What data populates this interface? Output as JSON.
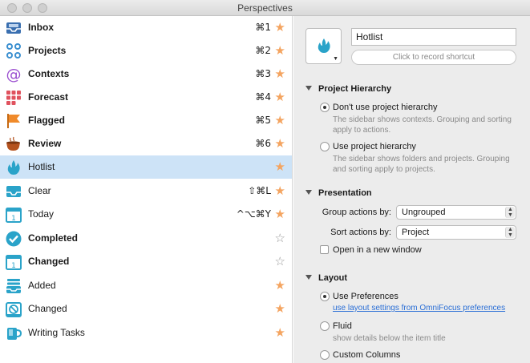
{
  "window": {
    "title": "Perspectives"
  },
  "perspectives": [
    {
      "label": "Inbox",
      "bold": true,
      "shortcut": "⌘1",
      "favorite": true,
      "icon": "inbox-icon",
      "color": "#3a6fb0"
    },
    {
      "label": "Projects",
      "bold": true,
      "shortcut": "⌘2",
      "favorite": true,
      "icon": "projects-icon",
      "color": "#3a8fd0"
    },
    {
      "label": "Contexts",
      "bold": true,
      "shortcut": "⌘3",
      "favorite": true,
      "icon": "contexts-icon",
      "color": "#9b4fd0"
    },
    {
      "label": "Forecast",
      "bold": true,
      "shortcut": "⌘4",
      "favorite": true,
      "icon": "forecast-icon",
      "color": "#e0525e"
    },
    {
      "label": "Flagged",
      "bold": true,
      "shortcut": "⌘5",
      "favorite": true,
      "icon": "flag-icon",
      "color": "#f08a2a"
    },
    {
      "label": "Review",
      "bold": true,
      "shortcut": "⌘6",
      "favorite": true,
      "icon": "review-icon",
      "color": "#b5521e"
    },
    {
      "label": "Hotlist",
      "bold": false,
      "shortcut": "",
      "favorite": true,
      "icon": "hotlist-flame-icon",
      "color": "#2aa3c9",
      "selected": true
    },
    {
      "label": "Clear",
      "bold": false,
      "shortcut": "⇧⌘L",
      "favorite": true,
      "icon": "clear-tray-icon",
      "color": "#2aa3c9"
    },
    {
      "label": "Today",
      "bold": false,
      "shortcut": "^⌥⌘Y",
      "favorite": true,
      "icon": "calendar-icon",
      "color": "#2aa3c9"
    },
    {
      "label": "Completed",
      "bold": true,
      "shortcut": "",
      "favorite": false,
      "icon": "checkmark-icon",
      "color": "#2aa3c9"
    },
    {
      "label": "Changed",
      "bold": true,
      "shortcut": "",
      "favorite": false,
      "icon": "calendar-icon",
      "color": "#2aa3c9"
    },
    {
      "label": "Added",
      "bold": false,
      "shortcut": "",
      "favorite": true,
      "icon": "stack-tray-icon",
      "color": "#2aa3c9"
    },
    {
      "label": "Changed",
      "bold": false,
      "shortcut": "",
      "favorite": true,
      "icon": "no-sign-tray-icon",
      "color": "#2aa3c9"
    },
    {
      "label": "Writing Tasks",
      "bold": false,
      "shortcut": "",
      "favorite": true,
      "icon": "mug-icon",
      "color": "#2aa3c9"
    }
  ],
  "editor": {
    "name_value": "Hotlist",
    "shortcut_placeholder": "Click to record shortcut",
    "project_hierarchy": {
      "title": "Project Hierarchy",
      "options": [
        {
          "label": "Don't use project hierarchy",
          "checked": true,
          "desc_lines": [
            "The sidebar shows contexts. Grouping and sorting",
            "apply to actions."
          ]
        },
        {
          "label": "Use project hierarchy",
          "checked": false,
          "desc_lines": [
            "The sidebar shows folders and projects. Grouping",
            "and sorting apply to projects."
          ]
        }
      ]
    },
    "presentation": {
      "title": "Presentation",
      "group_label": "Group actions by:",
      "group_value": "Ungrouped",
      "sort_label": "Sort actions by:",
      "sort_value": "Project",
      "open_new_window_label": "Open in a new window",
      "open_new_window_checked": false
    },
    "layout": {
      "title": "Layout",
      "options": [
        {
          "label": "Use Preferences",
          "checked": true,
          "link": "use layout settings from OmniFocus preferences"
        },
        {
          "label": "Fluid",
          "checked": false,
          "desc": "show details below the item title"
        },
        {
          "label": "Custom Columns",
          "checked": false
        }
      ]
    }
  },
  "colors": {
    "selection": "#cde3f7",
    "star_on": "#f4a460",
    "accent_blue": "#2aa3c9",
    "panel_bg": "#ececec"
  }
}
